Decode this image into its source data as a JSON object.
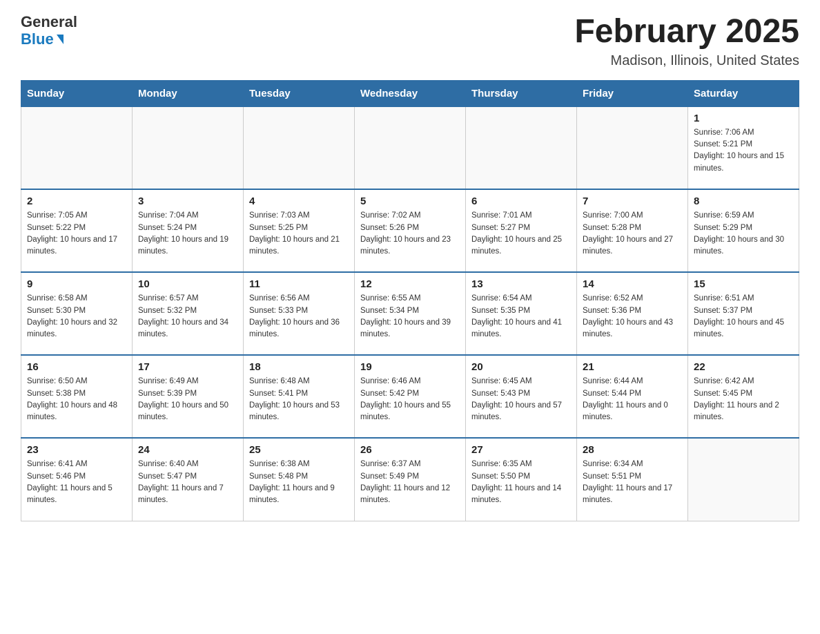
{
  "logo": {
    "general": "General",
    "blue": "Blue"
  },
  "header": {
    "month_year": "February 2025",
    "location": "Madison, Illinois, United States"
  },
  "weekdays": [
    "Sunday",
    "Monday",
    "Tuesday",
    "Wednesday",
    "Thursday",
    "Friday",
    "Saturday"
  ],
  "weeks": [
    [
      {
        "day": "",
        "sunrise": "",
        "sunset": "",
        "daylight": ""
      },
      {
        "day": "",
        "sunrise": "",
        "sunset": "",
        "daylight": ""
      },
      {
        "day": "",
        "sunrise": "",
        "sunset": "",
        "daylight": ""
      },
      {
        "day": "",
        "sunrise": "",
        "sunset": "",
        "daylight": ""
      },
      {
        "day": "",
        "sunrise": "",
        "sunset": "",
        "daylight": ""
      },
      {
        "day": "",
        "sunrise": "",
        "sunset": "",
        "daylight": ""
      },
      {
        "day": "1",
        "sunrise": "Sunrise: 7:06 AM",
        "sunset": "Sunset: 5:21 PM",
        "daylight": "Daylight: 10 hours and 15 minutes."
      }
    ],
    [
      {
        "day": "2",
        "sunrise": "Sunrise: 7:05 AM",
        "sunset": "Sunset: 5:22 PM",
        "daylight": "Daylight: 10 hours and 17 minutes."
      },
      {
        "day": "3",
        "sunrise": "Sunrise: 7:04 AM",
        "sunset": "Sunset: 5:24 PM",
        "daylight": "Daylight: 10 hours and 19 minutes."
      },
      {
        "day": "4",
        "sunrise": "Sunrise: 7:03 AM",
        "sunset": "Sunset: 5:25 PM",
        "daylight": "Daylight: 10 hours and 21 minutes."
      },
      {
        "day": "5",
        "sunrise": "Sunrise: 7:02 AM",
        "sunset": "Sunset: 5:26 PM",
        "daylight": "Daylight: 10 hours and 23 minutes."
      },
      {
        "day": "6",
        "sunrise": "Sunrise: 7:01 AM",
        "sunset": "Sunset: 5:27 PM",
        "daylight": "Daylight: 10 hours and 25 minutes."
      },
      {
        "day": "7",
        "sunrise": "Sunrise: 7:00 AM",
        "sunset": "Sunset: 5:28 PM",
        "daylight": "Daylight: 10 hours and 27 minutes."
      },
      {
        "day": "8",
        "sunrise": "Sunrise: 6:59 AM",
        "sunset": "Sunset: 5:29 PM",
        "daylight": "Daylight: 10 hours and 30 minutes."
      }
    ],
    [
      {
        "day": "9",
        "sunrise": "Sunrise: 6:58 AM",
        "sunset": "Sunset: 5:30 PM",
        "daylight": "Daylight: 10 hours and 32 minutes."
      },
      {
        "day": "10",
        "sunrise": "Sunrise: 6:57 AM",
        "sunset": "Sunset: 5:32 PM",
        "daylight": "Daylight: 10 hours and 34 minutes."
      },
      {
        "day": "11",
        "sunrise": "Sunrise: 6:56 AM",
        "sunset": "Sunset: 5:33 PM",
        "daylight": "Daylight: 10 hours and 36 minutes."
      },
      {
        "day": "12",
        "sunrise": "Sunrise: 6:55 AM",
        "sunset": "Sunset: 5:34 PM",
        "daylight": "Daylight: 10 hours and 39 minutes."
      },
      {
        "day": "13",
        "sunrise": "Sunrise: 6:54 AM",
        "sunset": "Sunset: 5:35 PM",
        "daylight": "Daylight: 10 hours and 41 minutes."
      },
      {
        "day": "14",
        "sunrise": "Sunrise: 6:52 AM",
        "sunset": "Sunset: 5:36 PM",
        "daylight": "Daylight: 10 hours and 43 minutes."
      },
      {
        "day": "15",
        "sunrise": "Sunrise: 6:51 AM",
        "sunset": "Sunset: 5:37 PM",
        "daylight": "Daylight: 10 hours and 45 minutes."
      }
    ],
    [
      {
        "day": "16",
        "sunrise": "Sunrise: 6:50 AM",
        "sunset": "Sunset: 5:38 PM",
        "daylight": "Daylight: 10 hours and 48 minutes."
      },
      {
        "day": "17",
        "sunrise": "Sunrise: 6:49 AM",
        "sunset": "Sunset: 5:39 PM",
        "daylight": "Daylight: 10 hours and 50 minutes."
      },
      {
        "day": "18",
        "sunrise": "Sunrise: 6:48 AM",
        "sunset": "Sunset: 5:41 PM",
        "daylight": "Daylight: 10 hours and 53 minutes."
      },
      {
        "day": "19",
        "sunrise": "Sunrise: 6:46 AM",
        "sunset": "Sunset: 5:42 PM",
        "daylight": "Daylight: 10 hours and 55 minutes."
      },
      {
        "day": "20",
        "sunrise": "Sunrise: 6:45 AM",
        "sunset": "Sunset: 5:43 PM",
        "daylight": "Daylight: 10 hours and 57 minutes."
      },
      {
        "day": "21",
        "sunrise": "Sunrise: 6:44 AM",
        "sunset": "Sunset: 5:44 PM",
        "daylight": "Daylight: 11 hours and 0 minutes."
      },
      {
        "day": "22",
        "sunrise": "Sunrise: 6:42 AM",
        "sunset": "Sunset: 5:45 PM",
        "daylight": "Daylight: 11 hours and 2 minutes."
      }
    ],
    [
      {
        "day": "23",
        "sunrise": "Sunrise: 6:41 AM",
        "sunset": "Sunset: 5:46 PM",
        "daylight": "Daylight: 11 hours and 5 minutes."
      },
      {
        "day": "24",
        "sunrise": "Sunrise: 6:40 AM",
        "sunset": "Sunset: 5:47 PM",
        "daylight": "Daylight: 11 hours and 7 minutes."
      },
      {
        "day": "25",
        "sunrise": "Sunrise: 6:38 AM",
        "sunset": "Sunset: 5:48 PM",
        "daylight": "Daylight: 11 hours and 9 minutes."
      },
      {
        "day": "26",
        "sunrise": "Sunrise: 6:37 AM",
        "sunset": "Sunset: 5:49 PM",
        "daylight": "Daylight: 11 hours and 12 minutes."
      },
      {
        "day": "27",
        "sunrise": "Sunrise: 6:35 AM",
        "sunset": "Sunset: 5:50 PM",
        "daylight": "Daylight: 11 hours and 14 minutes."
      },
      {
        "day": "28",
        "sunrise": "Sunrise: 6:34 AM",
        "sunset": "Sunset: 5:51 PM",
        "daylight": "Daylight: 11 hours and 17 minutes."
      },
      {
        "day": "",
        "sunrise": "",
        "sunset": "",
        "daylight": ""
      }
    ]
  ]
}
